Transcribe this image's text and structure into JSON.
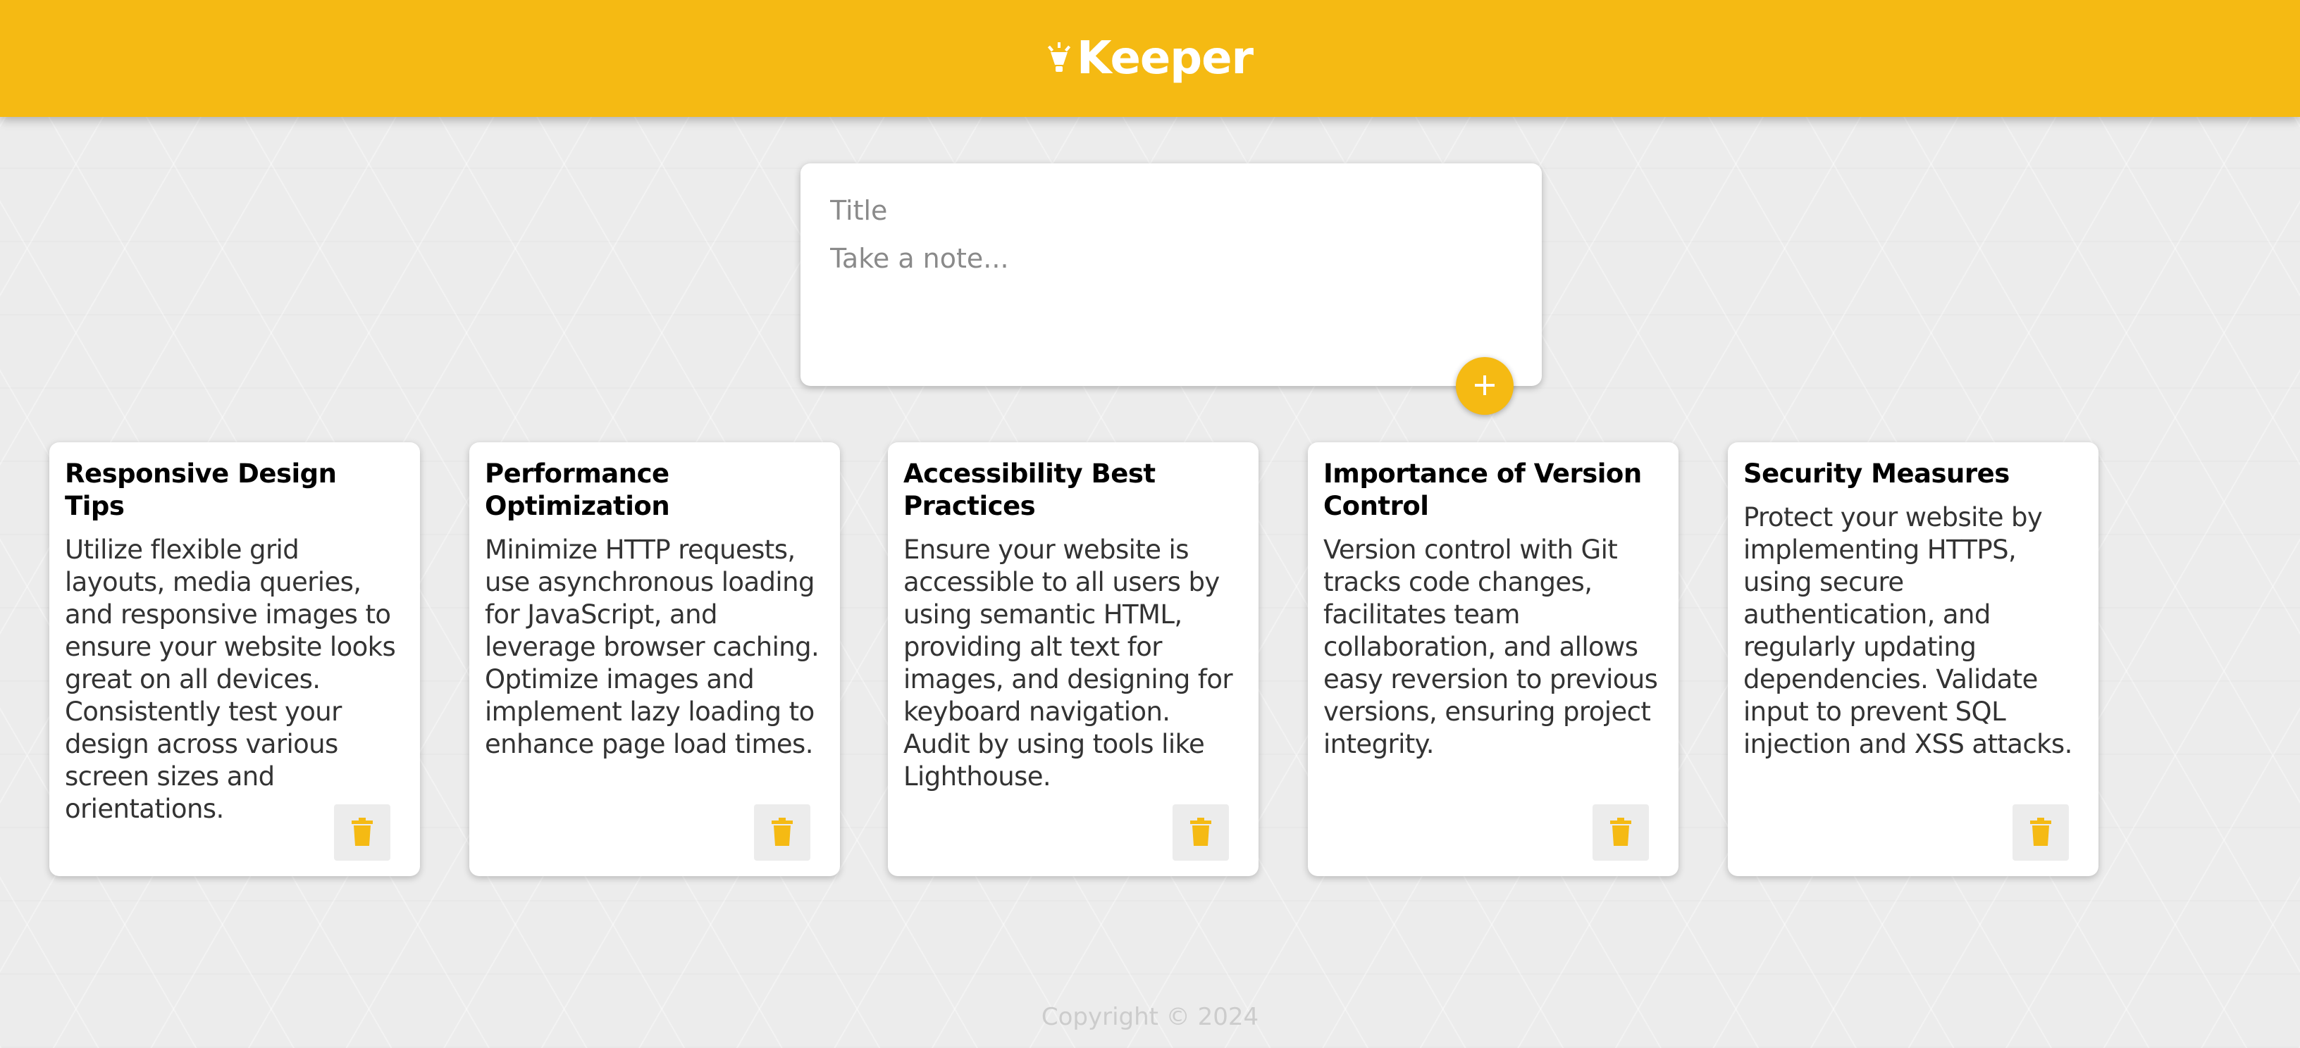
{
  "header": {
    "logo_text": "Keeper",
    "logo_icon": "lightbulb-icon",
    "background_color": "#f5ba13"
  },
  "create_area": {
    "title_placeholder": "Title",
    "content_placeholder": "Take a note...",
    "add_icon": "plus-icon"
  },
  "notes": [
    {
      "title": "Responsive Design Tips",
      "content": "Utilize flexible grid layouts, media queries, and responsive images to ensure your website looks great on all devices. Consistently test your design across various screen sizes and orientations.",
      "delete_icon": "trash-icon"
    },
    {
      "title": "Performance Optimization",
      "content": "Minimize HTTP requests, use asynchronous loading for JavaScript, and leverage browser caching. Optimize images and implement lazy loading to enhance page load times.",
      "delete_icon": "trash-icon"
    },
    {
      "title": "Accessibility Best Practices",
      "content": "Ensure your website is accessible to all users by using semantic HTML, providing alt text for images, and designing for keyboard navigation. Audit by using tools like Lighthouse.",
      "delete_icon": "trash-icon"
    },
    {
      "title": "Importance of Version Control",
      "content": "Version control with Git tracks code changes, facilitates team collaboration, and allows easy reversion to previous versions, ensuring project integrity.",
      "delete_icon": "trash-icon"
    },
    {
      "title": "Security Measures",
      "content": "Protect your website by implementing HTTPS, using secure authentication, and regularly updating dependencies. Validate input to prevent SQL injection and XSS attacks.",
      "delete_icon": "trash-icon"
    }
  ],
  "footer": {
    "copyright": "Copyright © 2024"
  },
  "colors": {
    "accent": "#f5ba13",
    "page_background": "#ececec",
    "card_background": "#ffffff"
  }
}
